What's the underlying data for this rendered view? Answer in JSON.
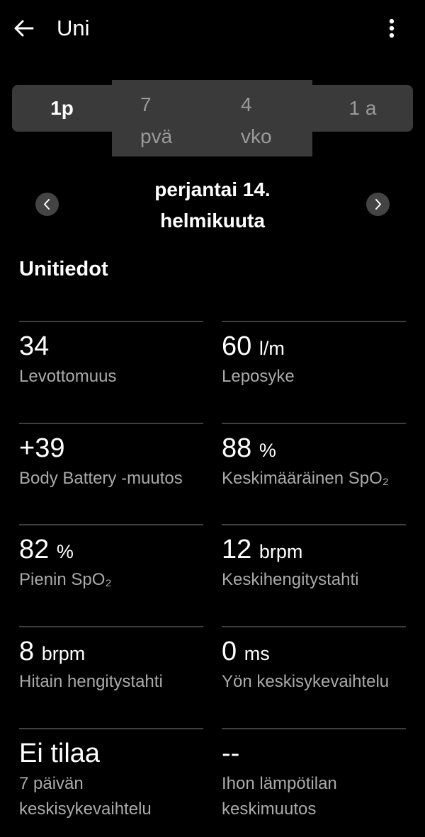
{
  "header": {
    "title": "Uni",
    "back_icon": "arrow-left-icon",
    "menu_icon": "more-vertical-icon"
  },
  "range_tabs": [
    {
      "label": "1p",
      "active": true
    },
    {
      "label_line1": "7",
      "label_line2": "pvä",
      "active": false
    },
    {
      "label_line1": "4",
      "label_line2": "vko",
      "active": false
    },
    {
      "label": "1 a",
      "active": false
    }
  ],
  "date_nav": {
    "line1": "perjantai 14.",
    "line2": "helmikuuta",
    "prev_icon": "chevron-left-icon",
    "next_icon": "chevron-right-icon"
  },
  "section_title": "Unitiedot",
  "stats": [
    {
      "value": "34",
      "unit": "",
      "label": "Levottomuus"
    },
    {
      "value": "60",
      "unit": "l/m",
      "label": "Leposyke"
    },
    {
      "value": "+39",
      "unit": "",
      "label": "Body Battery -muutos"
    },
    {
      "value": "88",
      "unit": "%",
      "label": "Keskimääräinen SpO₂"
    },
    {
      "value": "82",
      "unit": "%",
      "label": "Pienin SpO₂"
    },
    {
      "value": "12",
      "unit": "brpm",
      "label": "Keskihengitystahti"
    },
    {
      "value": "8",
      "unit": "brpm",
      "label": "Hitain hengitystahti"
    },
    {
      "value": "0",
      "unit": "ms",
      "label": "Yön keskisykevaihtelu"
    },
    {
      "value": "Ei tilaa",
      "unit": "",
      "label": "7 päivän keskisykevaihtelu"
    },
    {
      "value": "--",
      "unit": "",
      "label": "Ihon lämpötilan keskimuutos"
    }
  ],
  "colors": {
    "background": "#000000",
    "segment_bg": "#3a3a3a",
    "nav_button_bg": "#444444",
    "divider": "#3f3f3f",
    "secondary_text": "#aaaaaa"
  }
}
